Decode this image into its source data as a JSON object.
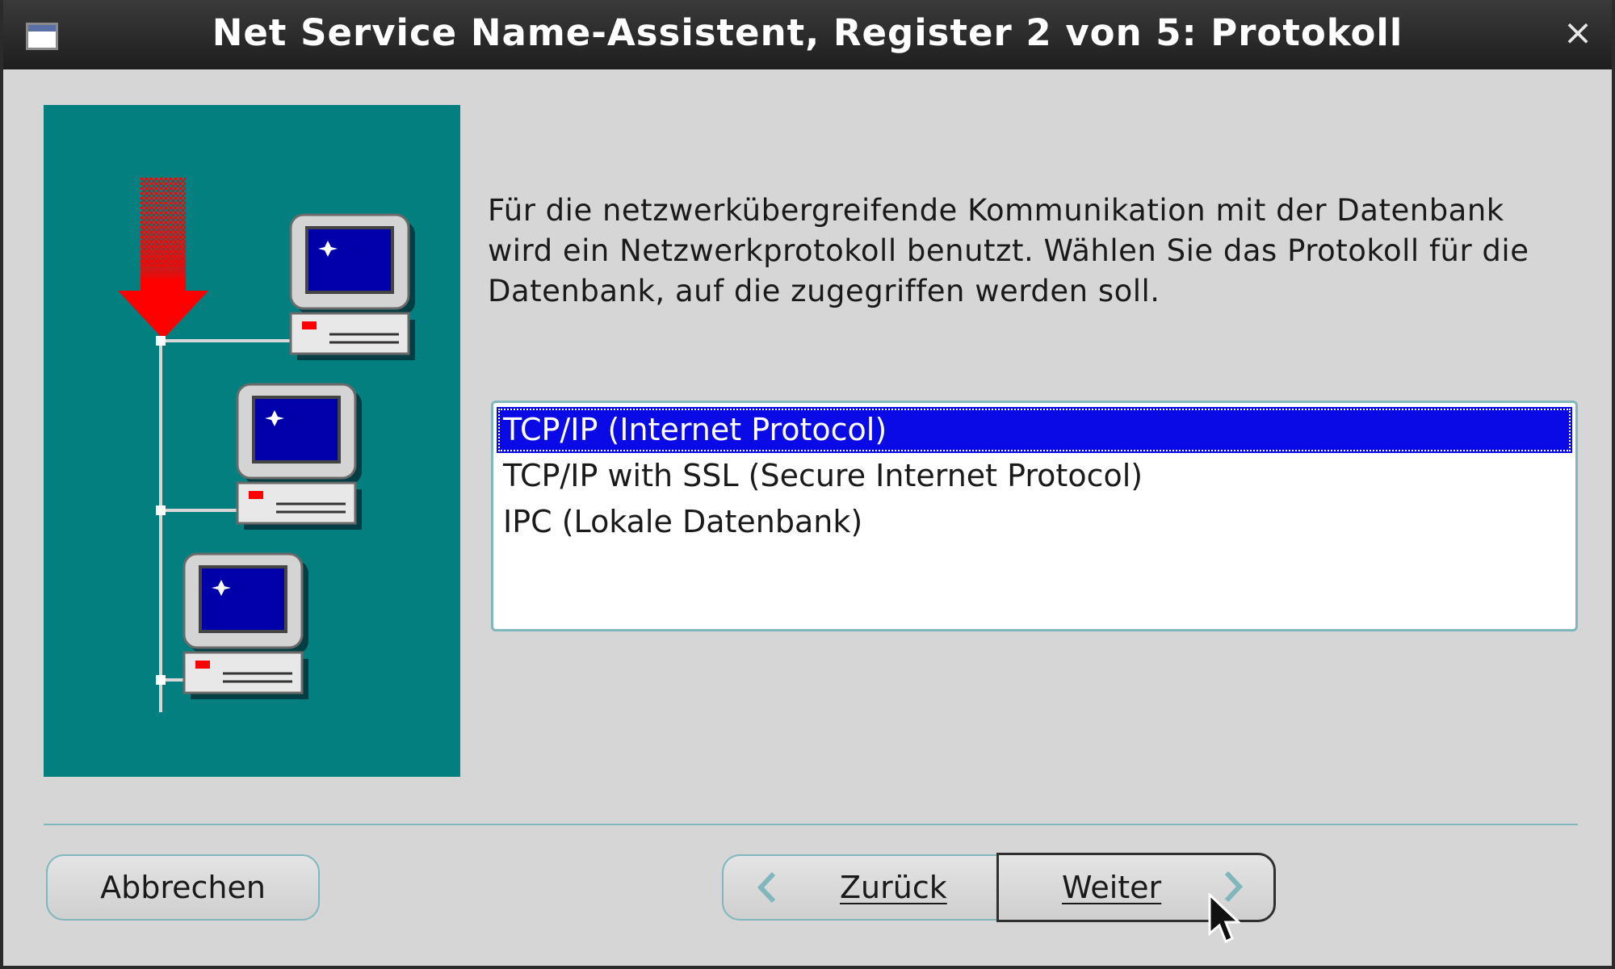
{
  "window": {
    "title": "Net Service Name-Assistent, Register 2 von 5: Protokoll",
    "close_glyph": "×"
  },
  "description": "Für die netzwerkübergreifende Kommunikation mit der Datenbank wird ein Netzwerkprotokoll benutzt. Wählen Sie das Protokoll für die Datenbank, auf die zugegriffen werden soll.",
  "protocols": {
    "items": [
      {
        "label": "TCP/IP (Internet Protocol)",
        "selected": true
      },
      {
        "label": "TCP/IP with SSL (Secure Internet Protocol)",
        "selected": false
      },
      {
        "label": "IPC (Lokale Datenbank)",
        "selected": false
      }
    ]
  },
  "buttons": {
    "cancel": "Abbrechen",
    "back": "Zurück",
    "next": "Weiter"
  },
  "colors": {
    "illustration_bg": "#047f80",
    "selection": "#0a0ae6",
    "arrow": "#ff0000",
    "screen": "#0000aa"
  }
}
